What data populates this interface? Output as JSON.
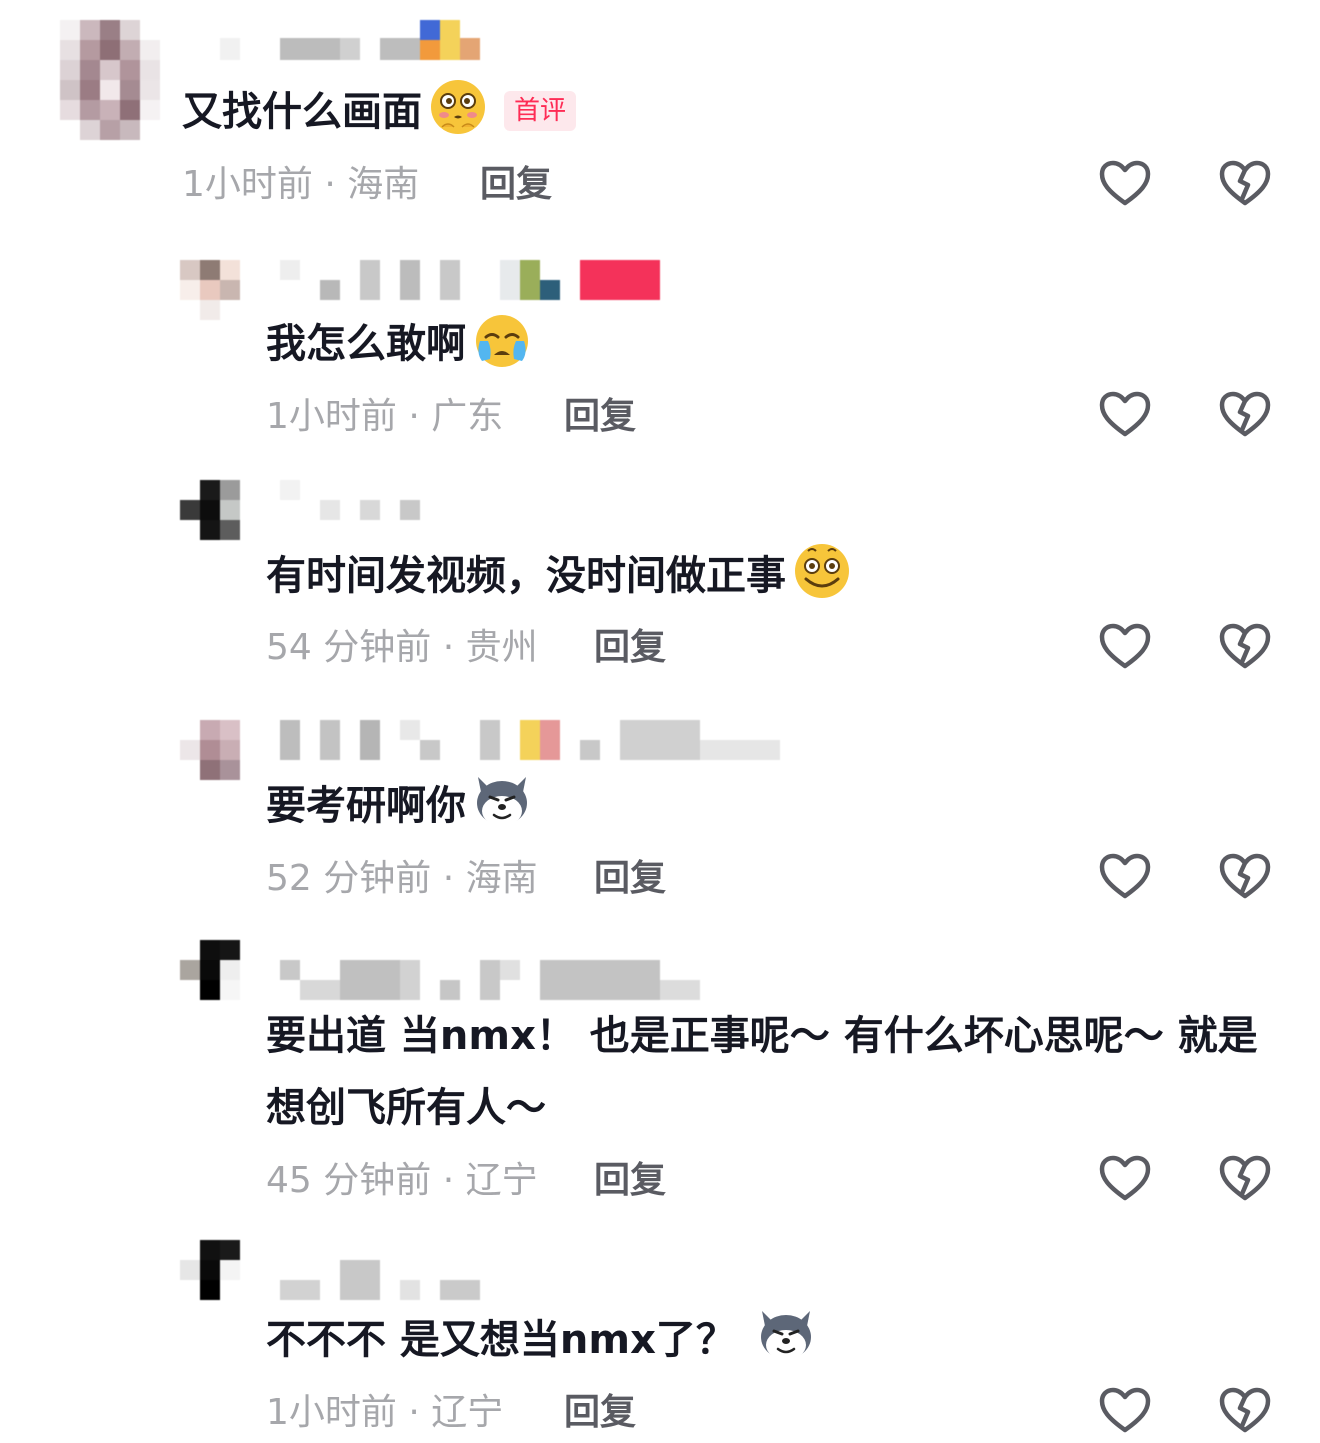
{
  "comments": [
    {
      "text": "又找什么画面",
      "emoji": "kissing-blushing-emoji",
      "badge": "首评",
      "meta": "1小时前 · 海南",
      "reply": "回复"
    },
    {
      "text": "我怎么敢啊",
      "emoji": "crying-emoji",
      "meta": "1小时前 · 广东",
      "reply": "回复"
    },
    {
      "text": "有时间发视频，没时间做正事",
      "emoji": "smiling-dizzy-emoji",
      "meta": "54 分钟前 · 贵州",
      "reply": "回复"
    },
    {
      "text": "要考研啊你",
      "emoji": "husky-dog-emoji",
      "meta": "52 分钟前 · 海南",
      "reply": "回复"
    },
    {
      "text": "要出道 当nmx！ 也是正事呢～ 有什么坏心思呢～ 就是想创飞所有人～",
      "meta": "45 分钟前 · 辽宁",
      "reply": "回复"
    },
    {
      "text": "不不不 是又想当nmx了？",
      "emoji": "husky-dog-emoji",
      "meta": "1小时前 · 辽宁",
      "reply": "回复"
    }
  ],
  "icons": {
    "like": "heart-outline-icon",
    "dislike": "broken-heart-outline-icon"
  },
  "colors": {
    "text": "#161823",
    "meta": "#a6a7ab",
    "reply": "#5a5b62",
    "badge_bg": "#fde8ec",
    "badge_text": "#fe2c55"
  }
}
